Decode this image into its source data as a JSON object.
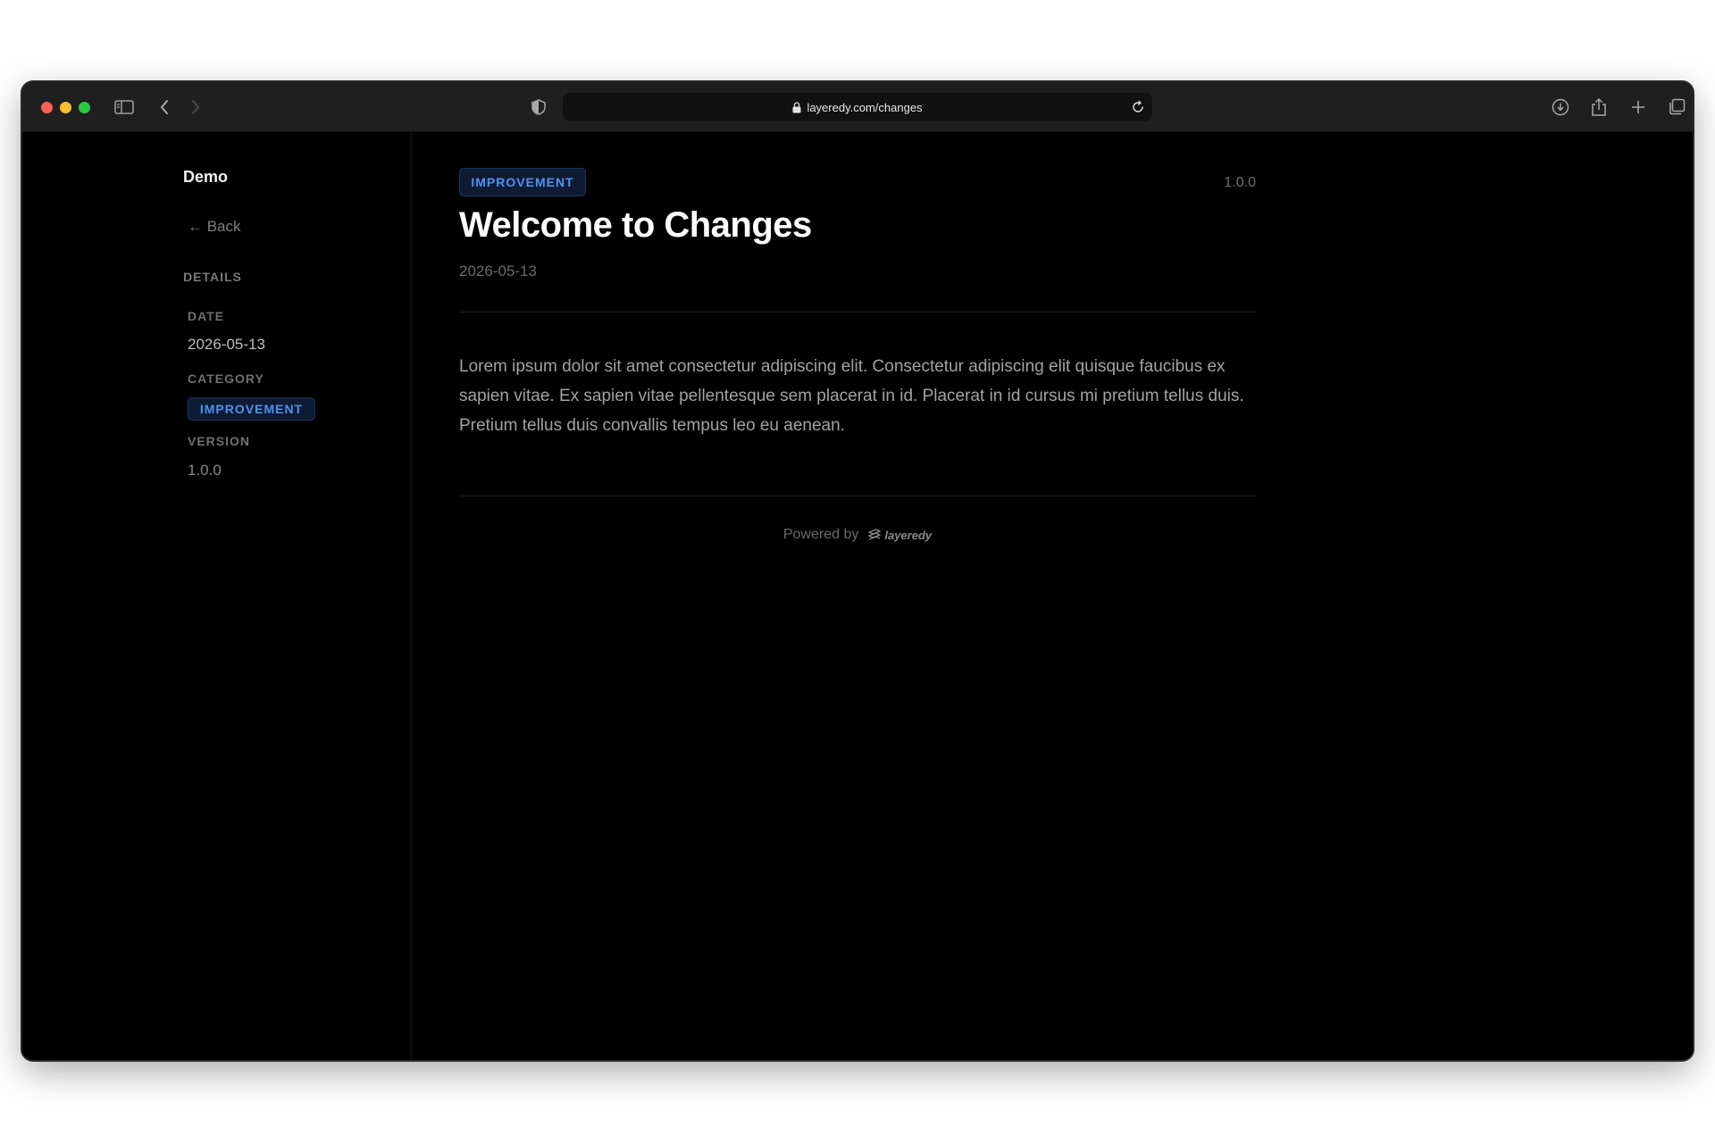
{
  "browser": {
    "url": "layeredy.com/changes"
  },
  "sidebar": {
    "brand": "Demo",
    "back_label": "← Back",
    "details_heading": "DETAILS",
    "date_label": "DATE",
    "date_value": "2026-05-13",
    "category_label": "CATEGORY",
    "category_value": "IMPROVEMENT",
    "version_label": "VERSION",
    "version_value": "1.0.0"
  },
  "entry": {
    "category": "IMPROVEMENT",
    "version": "1.0.0",
    "title": "Welcome to Changes",
    "date": "2026-05-13",
    "body": "Lorem ipsum dolor sit amet consectetur adipiscing elit. Consectetur adipiscing elit quisque faucibus ex sapien vitae. Ex sapien vitae pellentesque sem placerat in id. Placerat in id cursus mi pretium tellus duis. Pretium tellus duis convallis tempus leo eu aenean."
  },
  "footer": {
    "powered_by": "Powered by",
    "logo_text": "layeredy"
  },
  "colors": {
    "badge_text": "#4f93f0",
    "badge_bg": "#0d1b33",
    "page_bg": "#000000"
  }
}
